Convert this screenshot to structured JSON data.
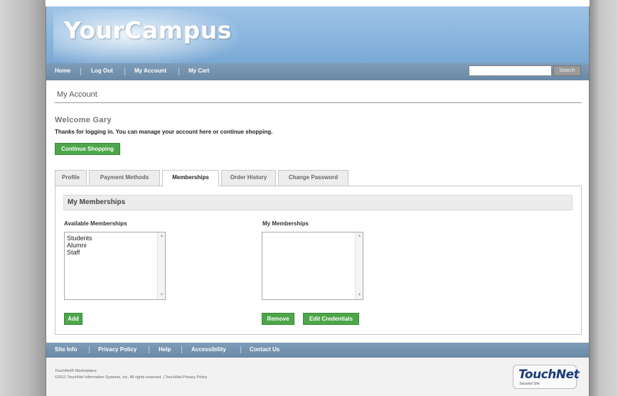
{
  "site": {
    "logo": "YourCampus"
  },
  "nav": {
    "items": [
      "Home",
      "Log Out",
      "My Account",
      "My Cart"
    ],
    "search_placeholder": "",
    "search_button": "Search"
  },
  "page": {
    "title": "My Account",
    "welcome": "Welcome Gary",
    "intro": "Thanks for logging in. You can manage your account here or continue shopping.",
    "continue_button": "Continue Shopping"
  },
  "tabs": [
    {
      "label": "Profile",
      "active": false
    },
    {
      "label": "Payment Methods",
      "active": false
    },
    {
      "label": "Memberships",
      "active": true
    },
    {
      "label": "Order History",
      "active": false
    },
    {
      "label": "Change Password",
      "active": false
    }
  ],
  "memberships": {
    "section_title": "My Memberships",
    "available_label": "Available Memberships",
    "available_options": [
      "Students",
      "Alumni",
      "Staff"
    ],
    "mine_label": "My Memberships",
    "mine_options": [],
    "add_button": "Add",
    "remove_button": "Remove",
    "edit_button": "Edit Credentials"
  },
  "footer": {
    "links": [
      "Site Info",
      "Privacy Policy",
      "Help",
      "Accessibility",
      "Contact Us"
    ],
    "brand_line": "TouchNet® Marketplace",
    "copyright": "©2011 TouchNet Information Systems, Inc. All rights reserved. | TouchNet Privacy Policy",
    "logo_text": "TouchNet",
    "logo_sub": "Secured Site"
  },
  "colors": {
    "banner": "#8db8e0",
    "navbar": "#6f8eab",
    "button_green": "#4ea64a"
  }
}
